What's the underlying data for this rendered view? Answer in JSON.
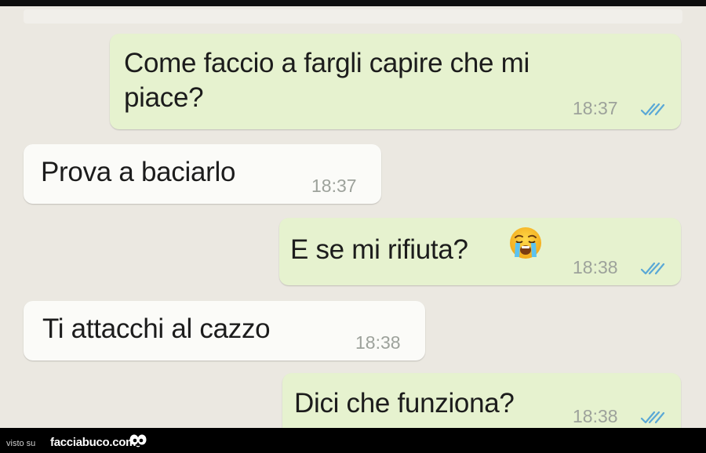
{
  "messages": [
    {
      "direction": "outgoing",
      "lines": [
        "Come faccio a fargli capire che mi",
        "piace?"
      ],
      "time": "18:37",
      "status": "read"
    },
    {
      "direction": "incoming",
      "lines": [
        "Prova a baciarlo"
      ],
      "time": "18:37"
    },
    {
      "direction": "outgoing",
      "lines": [
        "E se mi rifiuta?"
      ],
      "emoji": "loudly-crying-face",
      "time": "18:38",
      "status": "read"
    },
    {
      "direction": "incoming",
      "lines": [
        "Ti attacchi al cazzo"
      ],
      "time": "18:38"
    },
    {
      "direction": "outgoing",
      "lines": [
        "Dici che funziona?"
      ],
      "time": "18:38",
      "status": "read"
    }
  ],
  "footer": {
    "prefix": "visto su",
    "site": "facciabuco.com"
  },
  "colors": {
    "outgoing_bubble": "#e6f2cf",
    "incoming_bubble": "#fbfbf8",
    "background": "#ebe8e1",
    "read_ticks": "#5aa8d6"
  }
}
